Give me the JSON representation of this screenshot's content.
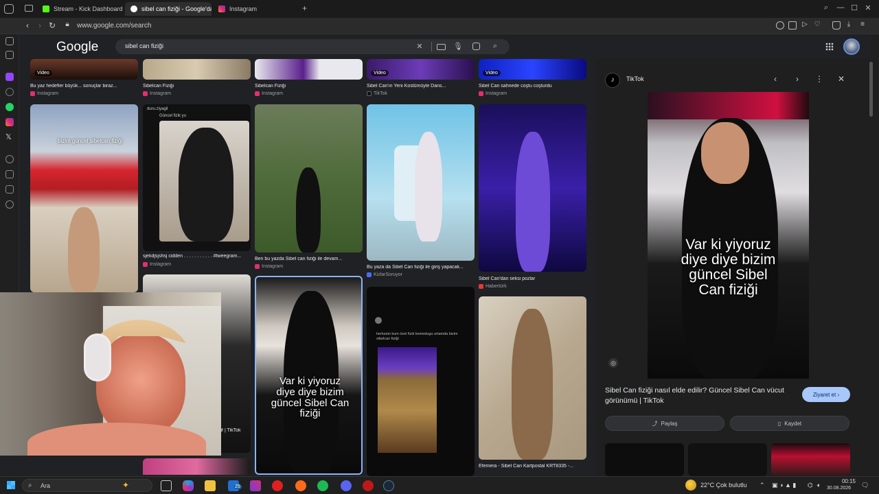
{
  "browser": {
    "tabs": [
      {
        "label": "Stream - Kick Dashboard",
        "active": false,
        "color": "#53fc18"
      },
      {
        "label": "sibel can fiziği - Google'da A",
        "active": true,
        "color": "#ffffff"
      },
      {
        "label": "Instagram",
        "active": false,
        "color": "#e1306c"
      }
    ],
    "new_tab_symbol": "+",
    "url": "www.google.com/search"
  },
  "google": {
    "logo": "Google",
    "query": "sibel can fiziği"
  },
  "results": {
    "row1": [
      {
        "caption": "Bu yaz hedefler büyük... sonuçlar biraz...",
        "source": "Instagram",
        "badge": "Video",
        "source_color": "#e1306c"
      },
      {
        "caption": "Sibelcan Fiziği",
        "source": "Instagram",
        "badge": "",
        "source_color": "#e1306c"
      },
      {
        "caption": "Sibelcan Fiziği",
        "source": "Instagram",
        "badge": "",
        "source_color": "#e1306c"
      },
      {
        "caption": "Sibel Can'ın Yeni Kostümüyle Dans...",
        "source": "TikTok",
        "badge": "Video",
        "source_color": "#111111"
      },
      {
        "caption": "Sibel Can sahnede coştu coşturdu",
        "source": "Instagram",
        "badge": "Video",
        "source_color": "#e1306c"
      }
    ],
    "row2": [
      {
        "caption": "",
        "source": "",
        "overlay": "bizim güncel sibelcan fiziği"
      },
      {
        "caption": "sjekdjsjshsj cidden . . . . . . . . . . . #tweegram...",
        "source": "Instagram",
        "source_color": "#e1306c",
        "tweet_user": "duru.ziyagil",
        "tweet_text": "Güncel fizik yu"
      },
      {
        "caption": "Ben bu yazda Sibel can fiziği ile devam...",
        "source": "Instagram",
        "source_color": "#e1306c"
      },
      {
        "caption": "Bu yaza da Sibel Can fiziği ile giriş yapacak...",
        "source": "KizlarSoruyor",
        "source_color": "#4a6cf7"
      },
      {
        "caption": "Sibel Can'dan seksi pozlar",
        "source": "Habertürk",
        "source_color": "#e53935"
      }
    ],
    "row3": [
      {
        "caption": "yif | TikTok",
        "overlay": "Var ki yiyoruz diye diye bizim güncel Sibel Can fiziği"
      },
      {
        "caption": "",
        "tweet_text": "herkesin kum özel fizik kemedugu ortamda bizim sibelcan fiziği"
      },
      {
        "caption": "Efemera - Sibel Can Kartpostal KRT8335 -...",
        "source": ""
      }
    ],
    "badge_video": "Video"
  },
  "panel": {
    "source_name": "TikTok",
    "overlay_text": "Var ki yiyoruz diye diye bizim güncel Sibel Can fiziği",
    "description": "Sibel Can fiziği nasıl elde edilir? Güncel Sibel Can vücut görünümü | TikTok",
    "visit_label": "Ziyaret et",
    "share_label": "Paylaş",
    "save_label": "Kaydet"
  },
  "taskbar": {
    "search_placeholder": "Ara",
    "weather": "22°C  Çok bulutlu",
    "time": "00:15",
    "date": "30.08.2026",
    "badge_count": "25"
  },
  "icons": {
    "back": "back-icon",
    "forward": "forward-icon",
    "reload": "reload-icon",
    "clear": "close-icon",
    "keyboard": "keyboard-icon",
    "mic": "mic-icon",
    "lens": "lens-icon",
    "search": "search-icon",
    "apps": "apps-icon"
  }
}
